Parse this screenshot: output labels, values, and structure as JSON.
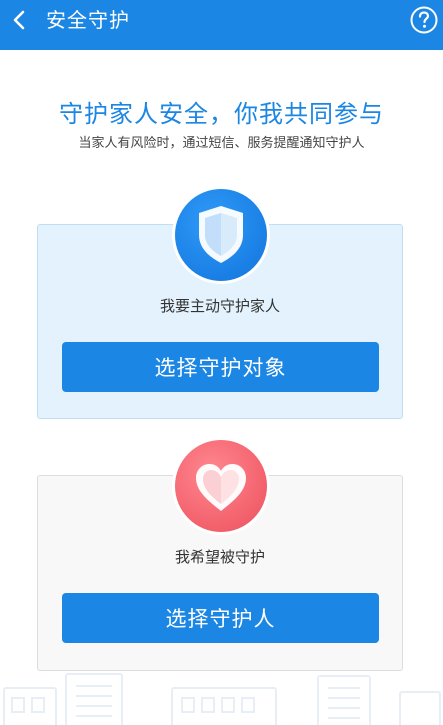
{
  "header": {
    "title": "安全守护",
    "help_icon": "help-circle-icon",
    "back_icon": "chevron-left-icon"
  },
  "intro": {
    "headline": "守护家人安全，你我共同参与",
    "subline": "当家人有风险时，通过短信、服务提醒通知守护人"
  },
  "cards": [
    {
      "icon": "shield-icon",
      "label": "我要主动守护家人",
      "button_label": "选择守护对象"
    },
    {
      "icon": "heart-icon",
      "label": "我希望被守护",
      "button_label": "选择守护人"
    }
  ],
  "colors": {
    "primary": "#1b86e3",
    "protect_card_bg": "#e3f2fd",
    "heart": "#f2606b"
  }
}
